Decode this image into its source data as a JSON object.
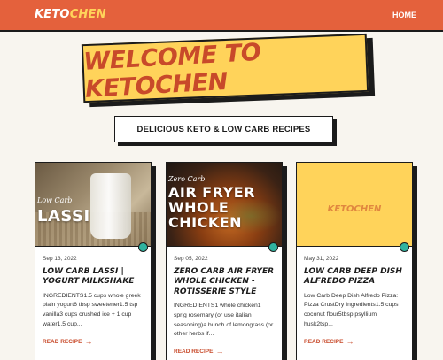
{
  "header": {
    "brand_part1": "KETO",
    "brand_part2": "CHEN",
    "nav_home": "HOME"
  },
  "hero": {
    "title": "WELCOME TO KETOCHEN",
    "subtitle": "DELICIOUS KETO & LOW CARB RECIPES"
  },
  "colors": {
    "header_bg": "#e4613c",
    "accent_yellow": "#ffd35a",
    "accent_red": "#c84a2a",
    "dot_teal": "#2fb3a0",
    "page_bg": "#f8f5ef"
  },
  "cards": [
    {
      "image_small": "Low Carb",
      "image_big": "LASSI",
      "date": "Sep 13, 2022",
      "title": "LOW CARB LASSI | YOGURT MILKSHAKE",
      "excerpt": "INGREDIENTS1.5 cups whole greek plain yogurt6 tbsp sweetener1.5 tsp vanilla3 cups crushed ice + 1 cup water1.5 cup...",
      "read_more": "READ RECIPE"
    },
    {
      "image_small": "Zero Carb",
      "image_big": "AIR FRYER WHOLE CHICKEN",
      "date": "Sep 05, 2022",
      "title": "ZERO CARB AIR FRYER WHOLE CHICKEN - ROTISSERIE STYLE",
      "excerpt": "INGREDIENTS1 whole chicken1 sprig rosemary (or use italian seasoning)a bunch of lemongrass (or other herbs if...",
      "read_more": "READ RECIPE"
    },
    {
      "image_watermark": "KETOCHEN",
      "date": "May 31, 2022",
      "title": "LOW CARB DEEP DISH ALFREDO PIZZA",
      "excerpt": "Low Carb Deep Dish Alfredo Pizza: Pizza CrustDry Ingredients1.5 cups coconut flour5tbsp psyllium husk2tsp...",
      "read_more": "READ RECIPE"
    }
  ]
}
